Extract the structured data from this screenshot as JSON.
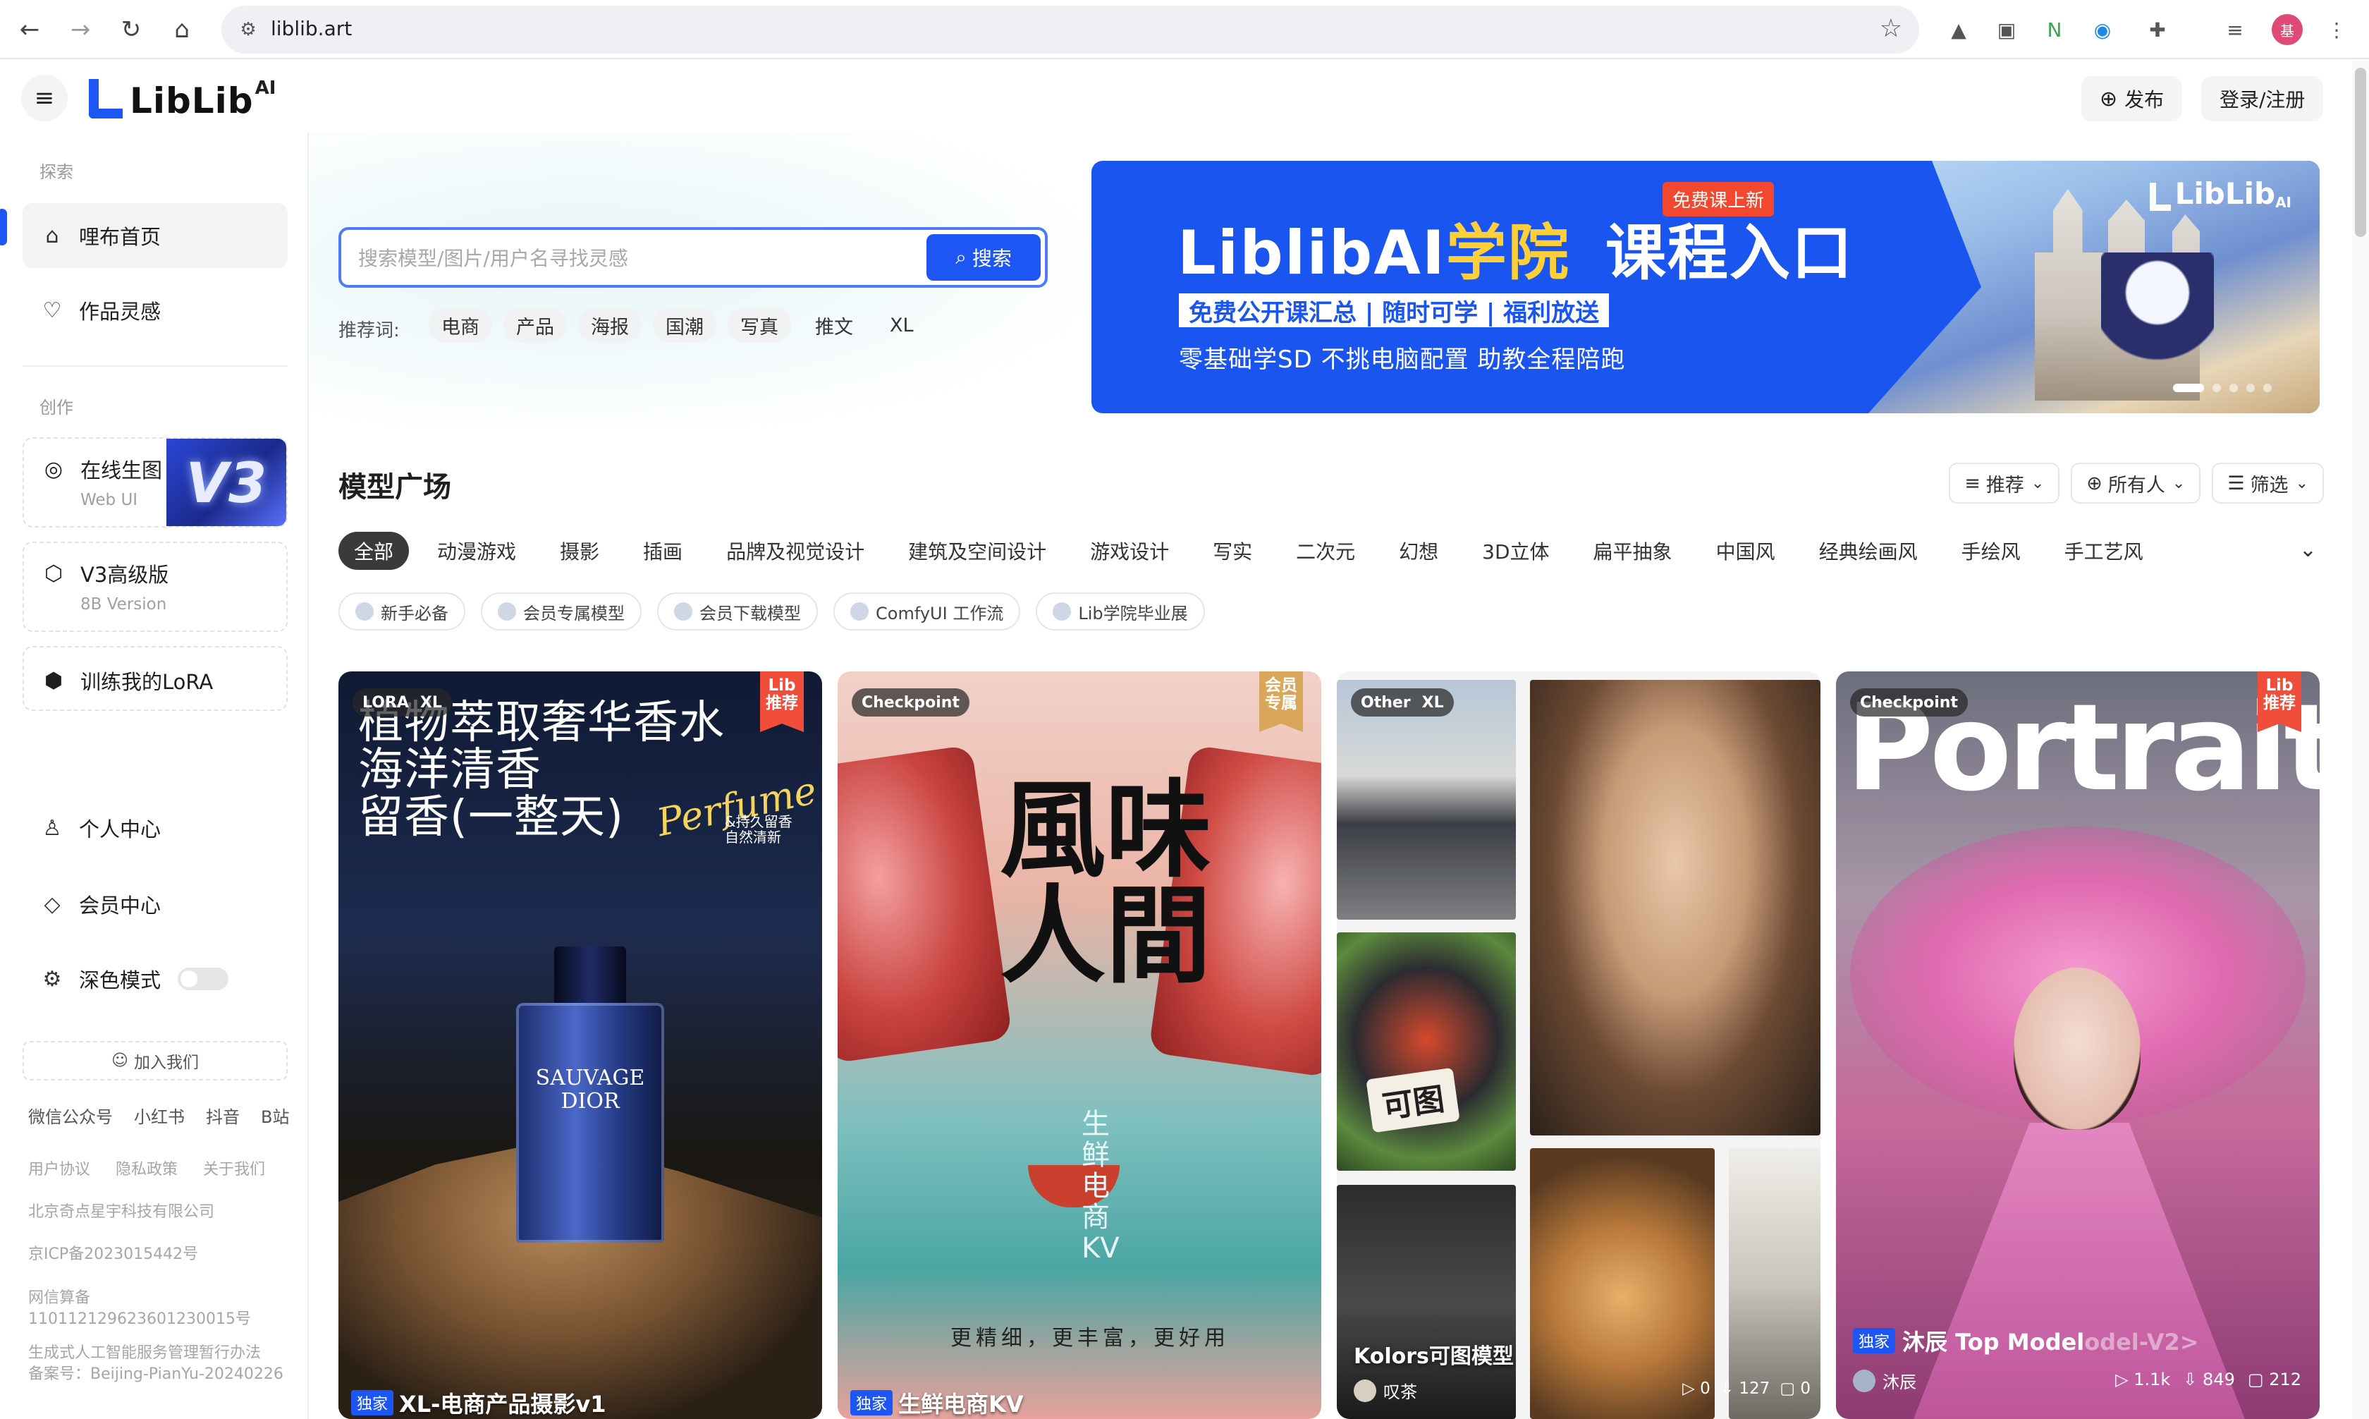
{
  "browser": {
    "url": "liblib.art",
    "profile_initial": "基"
  },
  "header": {
    "logo_text": "LibLib",
    "logo_suffix": "AI",
    "publish_label": "发布",
    "login_label": "登录/注册"
  },
  "sidebar": {
    "section_explore": "探索",
    "items": [
      {
        "label": "哩布首页",
        "icon": "home-icon"
      },
      {
        "label": "作品灵感",
        "icon": "lightbulb-icon"
      }
    ],
    "section_create": "创作",
    "online_gen": {
      "title": "在线生图",
      "subtitle": "Web UI",
      "art": "V3"
    },
    "v3_pro": {
      "title": "V3高级版",
      "subtitle": "8B Version"
    },
    "train_lora": "训练我的LoRA",
    "personal": "个人中心",
    "member": "会员中心",
    "dark_mode": "深色模式",
    "join": "加入我们",
    "social": [
      "微信公众号",
      "小红书",
      "抖音",
      "B站"
    ],
    "footer_links": [
      "用户协议",
      "隐私政策",
      "关于我们"
    ],
    "company": "北京奇点星宇科技有限公司",
    "icp": "京ICP备2023015442号",
    "netinfo_label": "网信算备",
    "netinfo_no": "110112129623601230015号",
    "genai_notice": "生成式人工智能服务管理暂行办法",
    "genai_no": "备案号：Beijing-PianYu-20240226"
  },
  "search": {
    "placeholder": "搜索模型/图片/用户名寻找灵感",
    "button": "搜索",
    "rec_label": "推荐词:",
    "rec_tags": [
      "电商",
      "产品",
      "海报",
      "国潮",
      "写真",
      "推文",
      "XL"
    ]
  },
  "banner": {
    "free_tag": "免费课上新",
    "title_part1": "LiblibAI",
    "title_part2": "学院",
    "title_part3": "课程入口",
    "strip": "免费公开课汇总 | 随时可学 | 福利放送",
    "sub": "零基础学SD  不挑电脑配置  助教全程陪跑",
    "logo": "LibLib",
    "logo_suffix": "AI"
  },
  "models": {
    "title": "模型广场",
    "sort_label": "推荐",
    "owner_label": "所有人",
    "filter_label": "筛选",
    "categories": [
      "全部",
      "动漫游戏",
      "摄影",
      "插画",
      "品牌及视觉设计",
      "建筑及空间设计",
      "游戏设计",
      "写实",
      "二次元",
      "幻想",
      "3D立体",
      "扁平抽象",
      "中国风",
      "经典绘画风",
      "手绘风",
      "手工艺风"
    ],
    "chips": [
      "新手必备",
      "会员专属模型",
      "会员下载模型",
      "ComfyUI 工作流",
      "Lib学院毕业展"
    ]
  },
  "cards": [
    {
      "type1": "LORA",
      "type2": "XL",
      "corner": "Lib\n推荐",
      "poster_title": "植物萃取奢华香水\n海洋清香\n留香(一整天)",
      "script": "Perfume",
      "script_sub": "&持久留香\n自然清新",
      "bottle_label": "SAUVAGE\nDIOR",
      "exclusive": "独家",
      "name": "XL-电商产品摄影v1"
    },
    {
      "type1": "Checkpoint",
      "corner": "会员\n专属",
      "poster_big": "風味\n人間",
      "poster_vertical": "生鲜电商KV",
      "poster_bottom": "更精细，更丰富，更好用",
      "exclusive": "独家",
      "name": "生鲜电商KV"
    },
    {
      "type1": "Other",
      "type2": "XL",
      "sign_text": "可图",
      "name": "Kolors可图模型",
      "author": "叹茶",
      "stat_runs": "0",
      "stat_downloads": "127",
      "stat_comments": "0"
    },
    {
      "type1": "Checkpoint",
      "corner": "Lib\n推荐",
      "poster_word": "Portrait",
      "exclusive": "独家",
      "name": "沐辰 Top Model",
      "name_ghost": "odel-V2>",
      "author": "沐辰",
      "stat_runs": "1.1k",
      "stat_downloads": "849",
      "stat_comments": "212"
    }
  ]
}
